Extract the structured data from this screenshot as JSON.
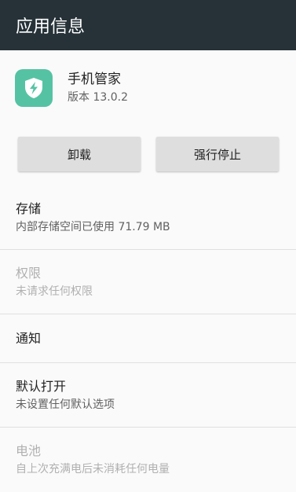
{
  "appbar": {
    "title": "应用信息"
  },
  "app": {
    "name": "手机管家",
    "version": "版本 13.0.2",
    "icon": "shield-lightning-icon",
    "icon_color": "#55c3a3"
  },
  "actions": {
    "uninstall_label": "卸载",
    "force_stop_label": "强行停止"
  },
  "settings": [
    {
      "title": "存储",
      "subtitle": "内部存储空间已使用 71.79 MB",
      "enabled": true
    },
    {
      "title": "权限",
      "subtitle": "未请求任何权限",
      "enabled": false
    },
    {
      "title": "通知",
      "enabled": true
    },
    {
      "title": "默认打开",
      "subtitle": "未设置任何默认选项",
      "enabled": true
    },
    {
      "title": "电池",
      "subtitle": "自上次充满电后未消耗任何电量",
      "enabled": false
    }
  ],
  "colors": {
    "appbar": "#263238",
    "button": "#dedede",
    "disabled_text": "#b0b0b0"
  }
}
